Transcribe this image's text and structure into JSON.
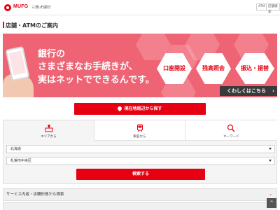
{
  "header": {
    "logo": "MUFG",
    "logo_sub": "三菱UFJ銀行",
    "atm_button": "ATM",
    "kinyu_button": "店舗検索"
  },
  "page_title": "店舗・ATMのご案内",
  "banner": {
    "line1": "銀行の",
    "line2": "さまざまなお手続きが、",
    "line3": "実はネットでできるんです。",
    "hex1": "口座開設",
    "hex2": "残高照会",
    "hex3": "振込・振替",
    "more": "くわしくはこちら",
    "more_arrow": "›"
  },
  "location_button": "現在地周辺から探す",
  "tabs": [
    {
      "label": "エリアから"
    },
    {
      "label": "駅名から"
    },
    {
      "label": "キーワード"
    }
  ],
  "selects": {
    "prefecture": "北海道",
    "city": "札幌市中央区"
  },
  "search_button": "検索する",
  "accordion": {
    "item1": "サービス内容・店舗形態から検索",
    "item2": "",
    "chevron": "⌄"
  },
  "to_top": "^",
  "colors": {
    "brand": "#e60012",
    "banner": "#ef6475"
  }
}
